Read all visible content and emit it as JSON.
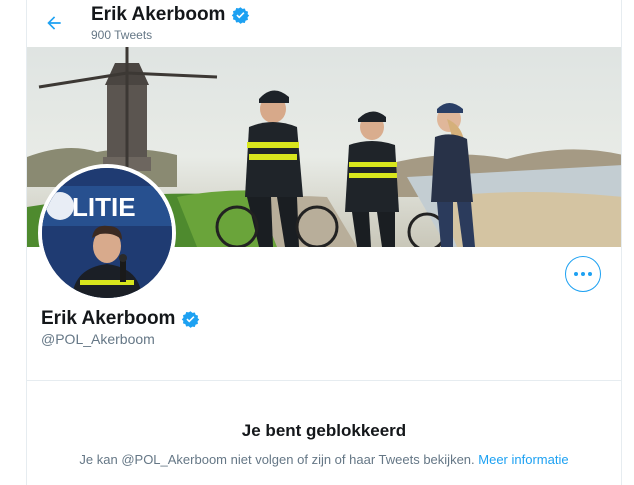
{
  "header": {
    "name": "Erik Akerboom",
    "tweets_count": "900 Tweets"
  },
  "banner": {
    "description": "Police officers with bicycles by a windmill"
  },
  "avatar": {
    "sign_text": "LITIE"
  },
  "profile": {
    "name": "Erik Akerboom",
    "handle": "@POL_Akerboom",
    "verified": true
  },
  "blocked": {
    "title": "Je bent geblokkeerd",
    "message": "Je kan @POL_Akerboom niet volgen of zijn of haar Tweets bekijken.",
    "link": "Meer informatie"
  },
  "colors": {
    "accent": "#1da1f2",
    "secondary_text": "#657786"
  },
  "icons": {
    "back": "arrow-left-icon",
    "verified": "verified-badge-icon",
    "more": "more-horizontal-icon"
  }
}
